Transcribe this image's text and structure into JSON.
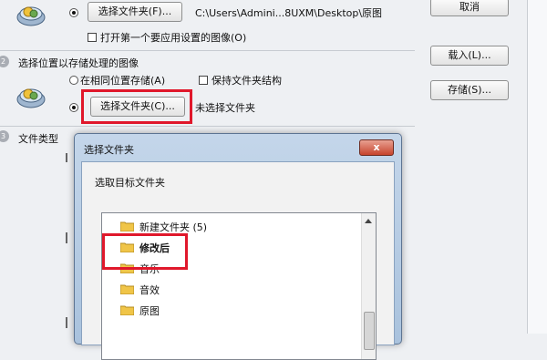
{
  "source": {
    "choose_folder_label": "选择文件夹(F)...",
    "path": "C:\\Users\\Admini...8UXM\\Desktop\\原图",
    "open_first_label": "打开第一个要应用设置的图像(O)"
  },
  "cancel_label": "取消",
  "destination": {
    "number": "2",
    "heading": "选择位置以存储处理的图像",
    "same_location_label": "在相同位置存储(A)",
    "keep_structure_label": "保持文件夹结构",
    "choose_folder_label": "选择文件夹(C)...",
    "status": "未选择文件夹"
  },
  "load_label": "载入(L)...",
  "save_label": "存储(S)...",
  "file_type": {
    "number": "3",
    "heading": "文件类型"
  },
  "dialog": {
    "title": "选择文件夹",
    "close_label": "x",
    "prompt": "选取目标文件夹",
    "items": [
      {
        "label": "新建文件夹 (5)"
      },
      {
        "label": "修改后"
      },
      {
        "label": "音乐"
      },
      {
        "label": "音效"
      },
      {
        "label": "原图"
      }
    ]
  }
}
